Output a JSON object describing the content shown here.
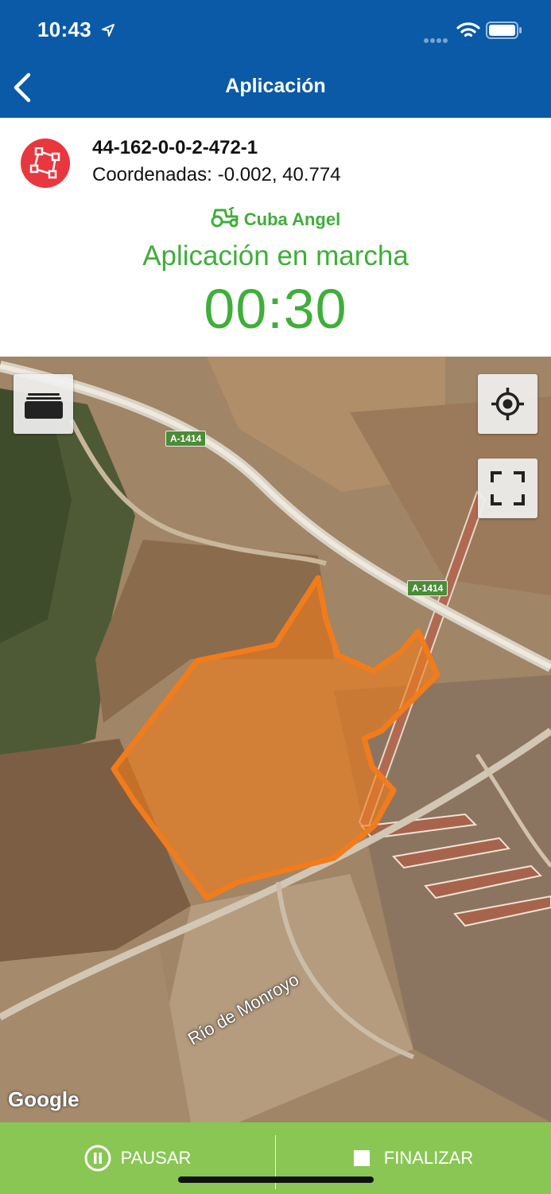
{
  "status_bar": {
    "time": "10:43"
  },
  "nav": {
    "title": "Aplicación",
    "back_icon": "chevron-left-icon"
  },
  "parcel": {
    "id": "44-162-0-0-2-472-1",
    "coords_label": "Coordenadas:",
    "coords_value": "-0.002, 40.774",
    "icon": "polygon-icon",
    "icon_color": "#e8373f"
  },
  "vehicle": {
    "name": "Cuba Angel",
    "icon": "tractor-icon"
  },
  "application": {
    "status": "Aplicación en marcha",
    "timer": "00:30"
  },
  "map": {
    "roads": [
      "A-1414",
      "A-1414"
    ],
    "river": "Río de Monroyo",
    "attribution": "Google",
    "field_color": "#f07c1c"
  },
  "actions": {
    "pause": "PAUSAR",
    "finish": "FINALIZAR"
  },
  "colors": {
    "header": "#0a5aa8",
    "accent_green": "#3fae3a",
    "bottom_bar": "#89c653"
  }
}
